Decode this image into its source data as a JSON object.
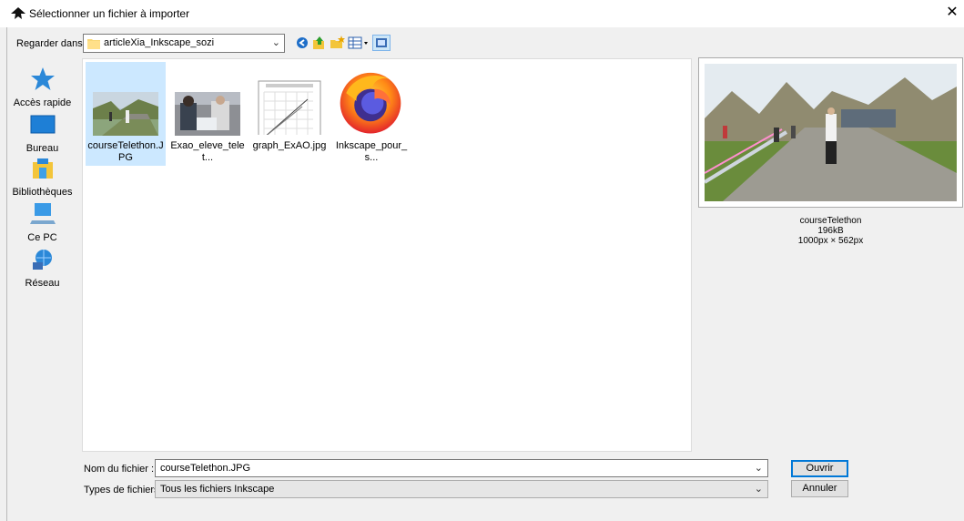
{
  "window": {
    "title": "Sélectionner un fichier à importer",
    "close_glyph": "✕"
  },
  "lookin": {
    "label": "Regarder dans :",
    "value": "articleXia_Inkscape_sozi",
    "arrow": "⌄"
  },
  "toolbar": [
    "back-icon",
    "up-folder-icon",
    "new-folder-icon",
    "view-menu-icon",
    "preview-toggle-icon"
  ],
  "places": [
    {
      "label": "Accès rapide",
      "icon": "star-icon"
    },
    {
      "label": "Bureau",
      "icon": "desktop-icon"
    },
    {
      "label": "Bibliothèques",
      "icon": "libraries-icon"
    },
    {
      "label": "Ce PC",
      "icon": "computer-icon"
    },
    {
      "label": "Réseau",
      "icon": "network-icon"
    }
  ],
  "files": [
    {
      "name": "courseTelethon.JPG",
      "selected": true
    },
    {
      "name": "Exao_eleve_telet...",
      "selected": false
    },
    {
      "name": "graph_ExAO.jpg",
      "selected": false
    },
    {
      "name": "Inkscape_pour_s...",
      "selected": false
    }
  ],
  "preview": {
    "name": "courseTelethon",
    "size": "196kB",
    "dimensions": "1000px × 562px"
  },
  "form": {
    "filename_label": "Nom du fichier :",
    "filename_value": "courseTelethon.JPG",
    "filetype_label": "Types de fichiers :",
    "filetype_value": "Tous les fichiers Inkscape",
    "arrow": "⌄",
    "open_label": "Ouvrir",
    "cancel_label": "Annuler"
  }
}
